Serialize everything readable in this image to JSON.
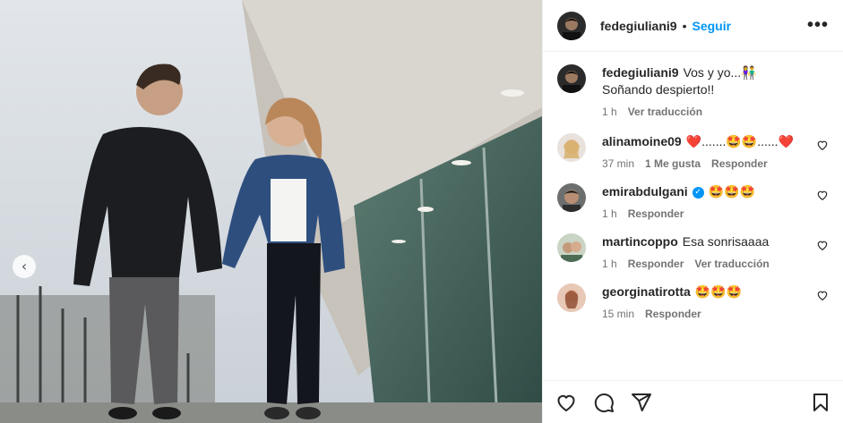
{
  "post": {
    "author": "fedegiuliani9",
    "follow_label": "Seguir",
    "separator": "•",
    "more_glyph": "•••",
    "prev_glyph": "‹"
  },
  "caption": {
    "username": "fedegiuliani9",
    "line1": "Vos y yo...👫",
    "line2": "Soñando despierto!!",
    "time": "1 h",
    "translate": "Ver traducción"
  },
  "comments": [
    {
      "username": "alinamoine09",
      "text": "❤️.......🤩🤩......❤️",
      "time": "37 min",
      "likes": "1 Me gusta",
      "reply": "Responder",
      "translate": "",
      "verified": false
    },
    {
      "username": "emirabdulgani",
      "text": "🤩🤩🤩",
      "time": "1 h",
      "likes": "",
      "reply": "Responder",
      "translate": "",
      "verified": true
    },
    {
      "username": "martincoppo",
      "text": "Esa sonrisaaaa",
      "time": "1 h",
      "likes": "",
      "reply": "Responder",
      "translate": "Ver traducción",
      "verified": false
    },
    {
      "username": "georginatirotta",
      "text": "🤩🤩🤩",
      "time": "15 min",
      "likes": "",
      "reply": "Responder",
      "translate": "",
      "verified": false
    }
  ],
  "icons": {
    "like": "heart-icon",
    "comment": "comment-icon",
    "share": "share-icon",
    "save": "bookmark-icon",
    "verified": "verified-badge-icon"
  },
  "colors": {
    "accent": "#0095f6",
    "verified": "#0095f6",
    "muted": "#737373"
  }
}
